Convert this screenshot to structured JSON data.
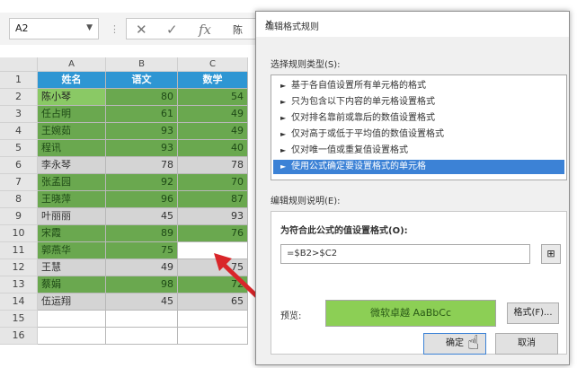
{
  "namebox": {
    "value": "A2",
    "dropdown_icon": "chevron-down-icon"
  },
  "formula_bar": {
    "cancel_glyph": "✕",
    "enter_glyph": "✓",
    "fx_glyph": "fx",
    "content": "陈"
  },
  "columns": [
    "A",
    "B",
    "C"
  ],
  "header_row": {
    "row": "1",
    "cells": [
      "姓名",
      "语文",
      "数学"
    ]
  },
  "rows": [
    {
      "row": "2",
      "name": "陈小琴",
      "chinese": "80",
      "math": "54",
      "style": "green"
    },
    {
      "row": "3",
      "name": "任占明",
      "chinese": "61",
      "math": "49",
      "style": "green"
    },
    {
      "row": "4",
      "name": "王婉茹",
      "chinese": "93",
      "math": "49",
      "style": "green"
    },
    {
      "row": "5",
      "name": "程讯",
      "chinese": "93",
      "math": "40",
      "style": "green"
    },
    {
      "row": "6",
      "name": "李永琴",
      "chinese": "78",
      "math": "78",
      "style": "gray"
    },
    {
      "row": "7",
      "name": "张孟园",
      "chinese": "92",
      "math": "70",
      "style": "green"
    },
    {
      "row": "8",
      "name": "王晓萍",
      "chinese": "96",
      "math": "87",
      "style": "green"
    },
    {
      "row": "9",
      "name": "叶丽丽",
      "chinese": "45",
      "math": "93",
      "style": "gray"
    },
    {
      "row": "10",
      "name": "宋霞",
      "chinese": "89",
      "math": "76",
      "style": "green"
    },
    {
      "row": "11",
      "name": "郭燕华",
      "chinese": "75",
      "math": "",
      "style": "green"
    },
    {
      "row": "12",
      "name": "王慧",
      "chinese": "49",
      "math": "75",
      "style": "gray"
    },
    {
      "row": "13",
      "name": "蔡娟",
      "chinese": "98",
      "math": "72",
      "style": "green"
    },
    {
      "row": "14",
      "name": "伍运翔",
      "chinese": "45",
      "math": "65",
      "style": "gray"
    }
  ],
  "extra_rows": [
    "15",
    "16"
  ],
  "dialog": {
    "title": "编辑格式规则",
    "close_glyph": "✕",
    "rule_type_label": "选择规则类型(S):",
    "rule_types": [
      "基于各自值设置所有单元格的格式",
      "只为包含以下内容的单元格设置格式",
      "仅对排名靠前或靠后的数值设置格式",
      "仅对高于或低于平均值的数值设置格式",
      "仅对唯一值或重复值设置格式",
      "使用公式确定要设置格式的单元格"
    ],
    "selected_rule_index": 5,
    "description_label": "编辑规则说明(E):",
    "formula_label": "为符合此公式的值设置格式(O):",
    "formula_value": "=$B2>$C2",
    "preview_label": "预览:",
    "preview_text": "微软卓越 AaBbCc",
    "format_button": "格式(F)...",
    "ok_button": "确定",
    "cancel_button": "取消"
  }
}
